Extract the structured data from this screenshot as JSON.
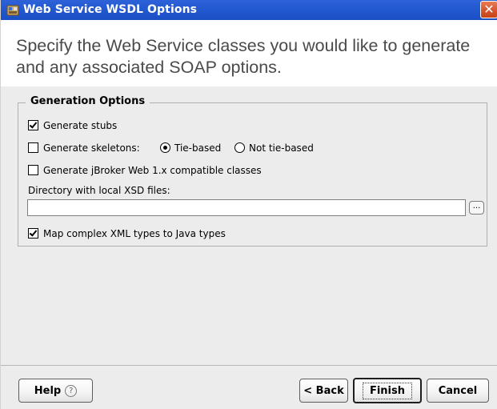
{
  "window": {
    "title": "Web Service WSDL Options",
    "close_label": "✕"
  },
  "header": {
    "instruction": "Specify the Web Service classes you would like to generate and any associated SOAP options."
  },
  "generation_options": {
    "title": "Generation Options",
    "generate_stubs": {
      "label": "Generate stubs",
      "checked": true
    },
    "generate_skeletons": {
      "label": "Generate skeletons:",
      "checked": false
    },
    "tie_based": {
      "label": "Tie-based",
      "selected": true
    },
    "not_tie_based": {
      "label": "Not tie-based",
      "selected": false
    },
    "jbroker_compat": {
      "label": "Generate jBroker Web 1.x compatible classes",
      "checked": false
    },
    "xsd_directory": {
      "label": "Directory with local XSD files:",
      "value": "",
      "browse_label": "..."
    },
    "map_complex": {
      "label": "Map complex XML types to Java types",
      "checked": true
    }
  },
  "footer": {
    "help_label": "Help",
    "help_icon": "?",
    "back_label": "< Back",
    "finish_label": "Finish",
    "cancel_label": "Cancel"
  }
}
